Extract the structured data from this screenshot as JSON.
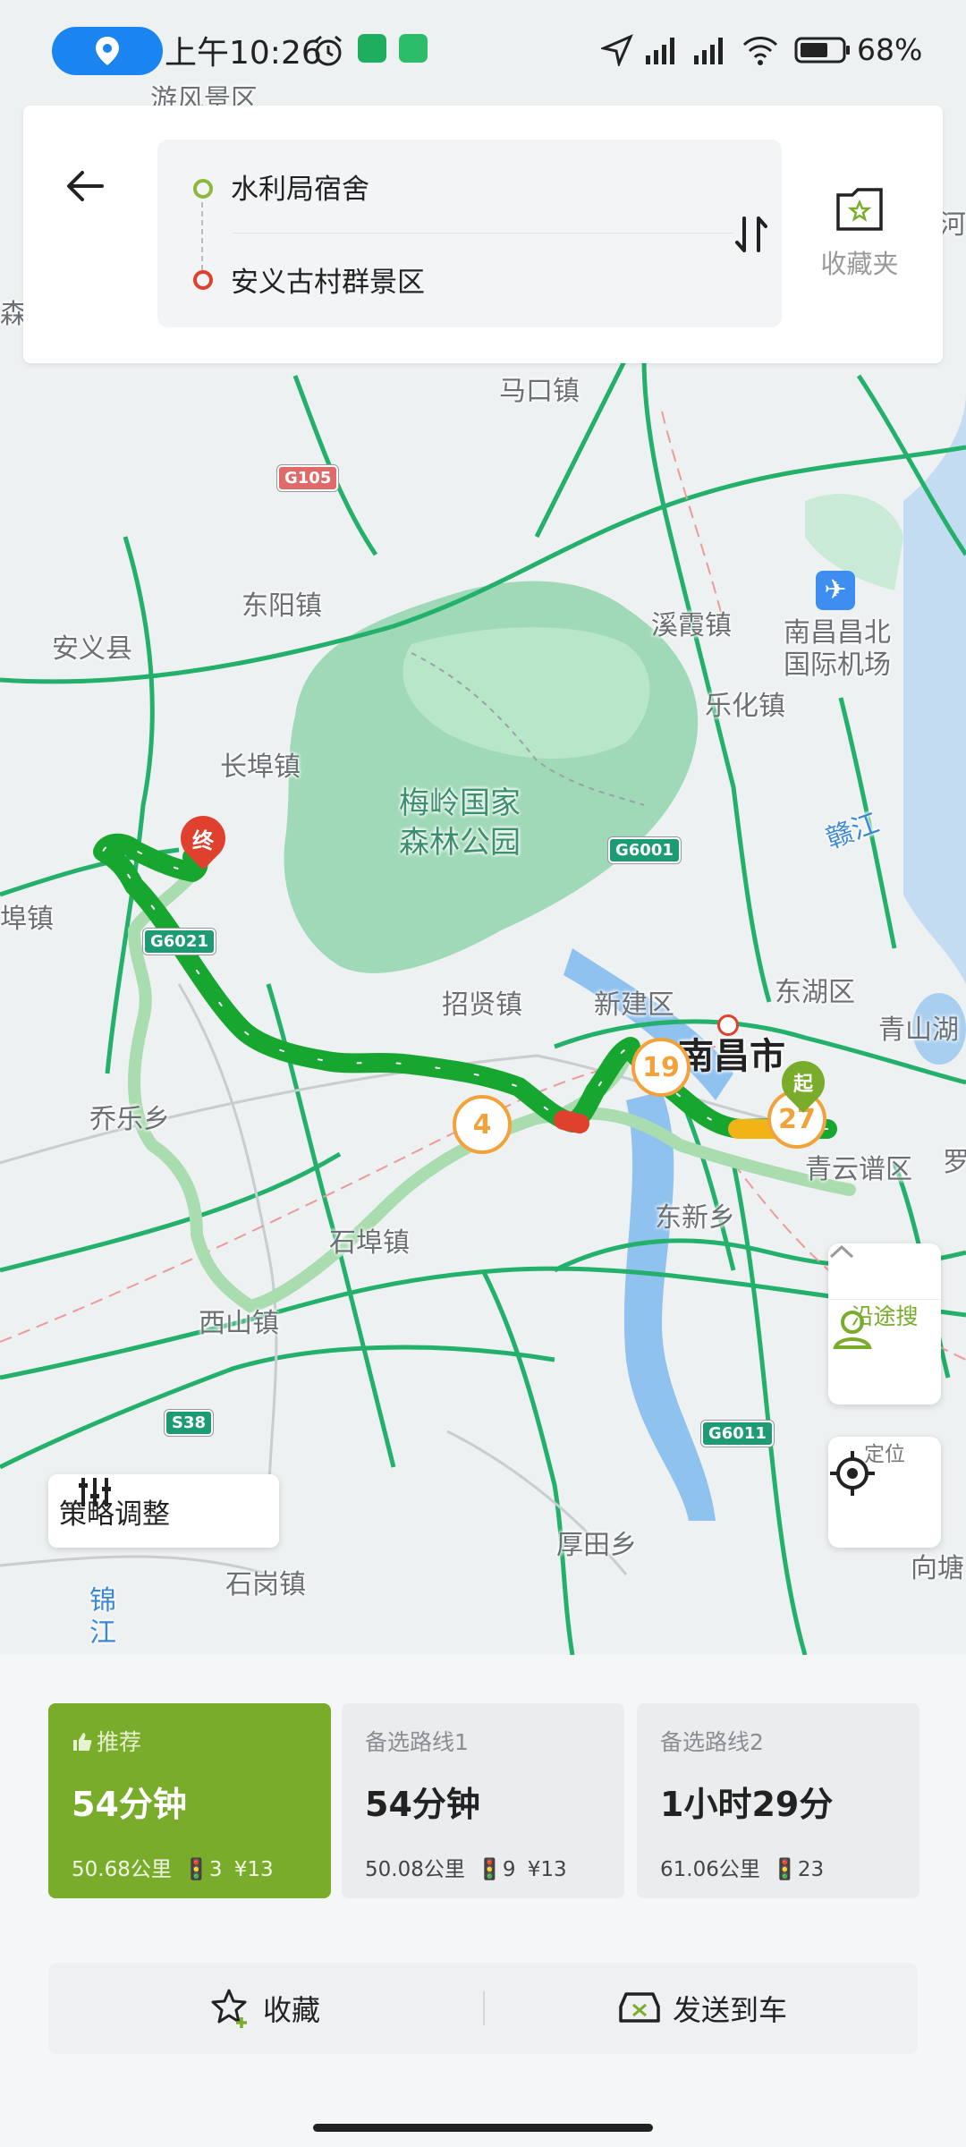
{
  "status_bar": {
    "time": "上午10:26",
    "battery_percent": "68%",
    "icons": [
      "location-pill-icon",
      "alarm-icon",
      "phone-app-icon",
      "shield-app-icon",
      "navigation-arrow-icon",
      "signal-hd-1-icon",
      "signal-hd-2-icon",
      "wifi-icon",
      "battery-icon"
    ]
  },
  "route": {
    "origin": "水利局宿舍",
    "destination": "安义古村群景区",
    "favorites_label": "收藏夹"
  },
  "map": {
    "labels": {
      "top_partial": "游风景区",
      "makou": "马口镇",
      "dongyang": "东阳镇",
      "anyi": "安义县",
      "xixia": "溪霞镇",
      "airport": "南昌昌北\n国际机场",
      "lehua": "乐化镇",
      "changbu": "长埠镇",
      "park": "梅岭国家\n森林公园",
      "ganjiang": "赣江",
      "left_edge": "埠镇",
      "donghu": "东湖区",
      "qingshanhu": "青山湖",
      "zhaoxian": "招贤镇",
      "xinjian": "新建区",
      "nanchang": "南昌市",
      "qiaole": "乔乐乡",
      "qingyunpu": "青云谱区",
      "luo": "罗",
      "dongxin": "东新乡",
      "shibu": "石埠镇",
      "xishan": "西山镇",
      "houtian": "厚田乡",
      "shigang": "石岗镇",
      "jinjiang": "锦\n江",
      "xiangtang": "向塘",
      "right_river": "河",
      "left_sen": "森"
    },
    "road_badges": [
      "G105",
      "G6001",
      "G6021",
      "S38",
      "G6011"
    ],
    "route_bubbles": [
      "4",
      "19",
      "27"
    ],
    "end_marker": "终",
    "start_marker": "起"
  },
  "controls": {
    "along_search": "沿途搜",
    "locate": "定位",
    "strategy": "策略调整"
  },
  "routes": [
    {
      "tag": "推荐",
      "time": "54分钟",
      "distance": "50.68公里",
      "lights": "3",
      "toll": "¥13"
    },
    {
      "tag": "备选路线1",
      "time": "54分钟",
      "distance": "50.08公里",
      "lights": "9",
      "toll": "¥13"
    },
    {
      "tag": "备选路线2",
      "time": "1小时29分",
      "distance": "61.06公里",
      "lights": "23",
      "toll": ""
    }
  ],
  "actions": {
    "favorite": "收藏",
    "send_to_car": "发送到车"
  },
  "colors": {
    "accent_green": "#7aac2b",
    "route_green": "#1fae36",
    "origin_dot": "#8cb83d",
    "destination_dot": "#e0412f",
    "bubble_orange": "#f2a23a"
  }
}
